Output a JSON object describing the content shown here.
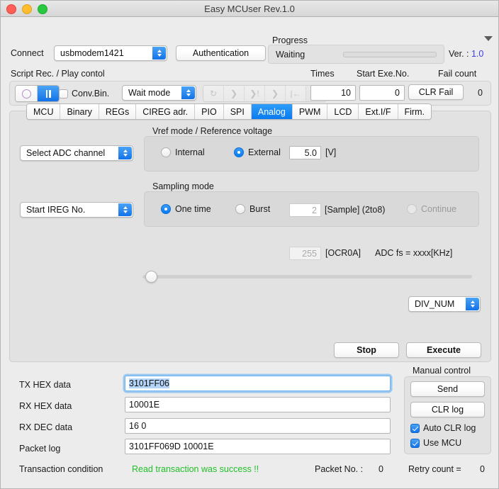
{
  "window": {
    "title": "Easy MCUser Rev.1.0",
    "traffic_lights": [
      "close-red",
      "minimize-yellow",
      "zoom-green"
    ]
  },
  "toolbar": {
    "connect_label": "Connect",
    "connect_port": "usbmodem1421",
    "authentication_label": "Authentication",
    "progress_label": "Progress",
    "progress_status": "Waiting",
    "progress_percent": 0,
    "version_label": "Ver. : ",
    "version_value": "1.0",
    "version_color": "#3c3ce6"
  },
  "script": {
    "section_label": "Script Rec. / Play contol",
    "times_label": "Times",
    "start_exe_label": "Start Exe.No.",
    "fail_count_label": "Fail count",
    "record_icon": "record-circle-icon",
    "pause_icon": "pause-icon",
    "conv_bin_label": "Conv.Bin.",
    "conv_bin_checked": false,
    "wait_mode": "Wait mode",
    "transport_icons": [
      "loop-icon",
      "step-icon",
      "step-break-icon",
      "step-alt-icon",
      "rewind-icon",
      "pause-icon"
    ],
    "times_value": "10",
    "start_exe_value": "0",
    "clr_fail_label": "CLR Fail",
    "fail_count_value": "0"
  },
  "tabs": [
    {
      "label": "MCU",
      "active": false
    },
    {
      "label": "Binary",
      "active": false
    },
    {
      "label": "REGs",
      "active": false
    },
    {
      "label": "CIREG adr.",
      "active": false
    },
    {
      "label": "PIO",
      "active": false
    },
    {
      "label": "SPI",
      "active": false
    },
    {
      "label": "Analog",
      "active": true
    },
    {
      "label": "PWM",
      "active": false
    },
    {
      "label": "LCD",
      "active": false
    },
    {
      "label": "Ext.I/F",
      "active": false
    },
    {
      "label": "Firm.",
      "active": false
    }
  ],
  "analog": {
    "adc_channel": "Select ADC channel",
    "ireg_no": "Start IREG No.",
    "vref": {
      "group_title": "Vref mode / Reference voltage",
      "internal_label": "Internal",
      "internal_selected": false,
      "external_label": "External",
      "external_selected": true,
      "voltage_value": "5.0",
      "voltage_unit": "[V]"
    },
    "sampling": {
      "group_title": "Sampling mode",
      "one_time_label": "One time",
      "one_time_selected": true,
      "burst_label": "Burst",
      "burst_selected": false,
      "burst_count": "2",
      "sample_unit": "[Sample] (2to8)",
      "continue_label": "Continue",
      "continue_enabled": false
    },
    "ocr_value": "255",
    "ocr_label": "[OCR0A]",
    "adc_fs_label": "ADC fs = xxxx[KHz]",
    "slider_position_percent": 1,
    "div_num": "DIV_NUM",
    "stop_label": "Stop",
    "execute_label": "Execute"
  },
  "data": {
    "tx_hex_label": "TX HEX data",
    "tx_hex_value": "3101FF06",
    "rx_hex_label": "RX HEX data",
    "rx_hex_value": "10001E",
    "rx_dec_label": "RX DEC data",
    "rx_dec_value": "16 0",
    "packet_log_label": "Packet log",
    "packet_log_value": "3101FF069D 10001E"
  },
  "manual": {
    "title": "Manual control",
    "send_label": "Send",
    "clr_log_label": "CLR log",
    "auto_clr_label": "Auto CLR log",
    "auto_clr_checked": true,
    "use_mcu_label": "Use MCU",
    "use_mcu_checked": true
  },
  "status": {
    "transaction_label": "Transaction condition",
    "transaction_status": "Read transaction was success !!",
    "transaction_color": "#22c02a",
    "packet_no_label": "Packet No. :",
    "packet_no_value": "0",
    "retry_label": "Retry count  =",
    "retry_value": "0"
  }
}
